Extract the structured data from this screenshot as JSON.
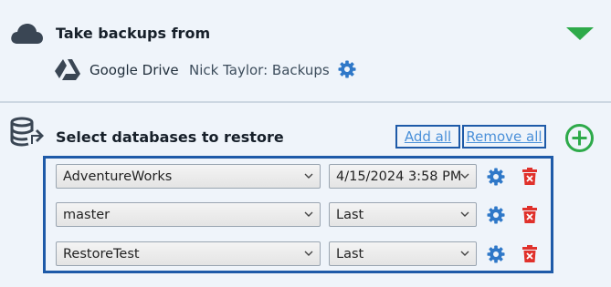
{
  "source": {
    "title": "Take backups from",
    "provider": "Google Drive",
    "account": "Nick Taylor: Backups",
    "icons": {
      "section": "cloud-icon",
      "toggle": "collapse-triangle-icon",
      "provider": "google-drive-icon",
      "settings": "gear-icon"
    }
  },
  "restore": {
    "title": "Select databases to restore",
    "add_all_label": "Add all",
    "remove_all_label": "Remove all",
    "icons": {
      "section": "database-restore-icon",
      "add": "add-circle-icon",
      "settings": "gear-icon",
      "delete": "trash-icon"
    },
    "rows": [
      {
        "database": "AdventureWorks",
        "restore_point": "4/15/2024 3:58 PM"
      },
      {
        "database": "master",
        "restore_point": "Last"
      },
      {
        "database": "RestoreTest",
        "restore_point": "Last"
      }
    ]
  },
  "colors": {
    "background": "#eff4fa",
    "accent_green": "#2eaa4a",
    "gear_blue": "#2f78c8",
    "delete_red": "#e0312b",
    "highlight_border": "#1e5aa8",
    "link_blue": "#4a90d9"
  }
}
